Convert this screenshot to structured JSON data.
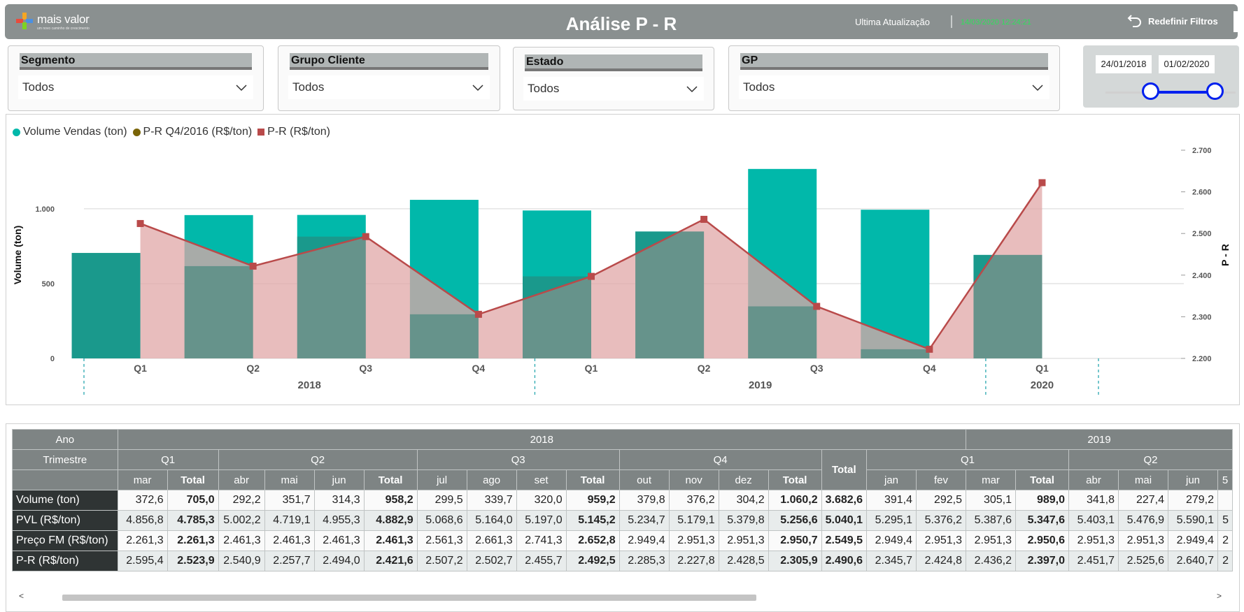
{
  "header": {
    "logo_text": "mais valor",
    "logo_sub": "um novo caminho de crescimento",
    "title": "Análise P - R",
    "update_label": "Ultima  Atualização",
    "update_time": "14/03/2020 12:24:21",
    "reset_label": "Redefinir Filtros",
    "reset_icon": "undo-icon"
  },
  "slicers": [
    {
      "title": "Segmento",
      "value": "Todos"
    },
    {
      "title": "Grupo Cliente",
      "value": "Todos"
    },
    {
      "title": "Estado",
      "value": "Todos"
    },
    {
      "title": "GP",
      "value": "Todos"
    }
  ],
  "date_slicer": {
    "start": "24/01/2018",
    "end": "01/02/2020",
    "start_fraction": 0.0,
    "end_fraction": 1.0
  },
  "colors": {
    "volume": "#01b8aa",
    "pr_q4": "#7a6408",
    "pr": "#b94a4a",
    "area_fill": "#e0a7a7",
    "header": "#8a9090"
  },
  "legend": [
    {
      "label": "Volume Vendas (ton)",
      "shape": "circle",
      "color": "#01b8aa"
    },
    {
      "label": "P-R Q4/2016 (R$/ton)",
      "shape": "circle",
      "color": "#7a6408"
    },
    {
      "label": "P-R (R$/ton)",
      "shape": "square",
      "color": "#b94a4a"
    }
  ],
  "chart_data": {
    "type": "bar",
    "categories": [
      "Q1",
      "Q2",
      "Q3",
      "Q4",
      "Q1",
      "Q2",
      "Q3",
      "Q4",
      "Q1"
    ],
    "groups": [
      {
        "label": "2018",
        "span": 4
      },
      {
        "label": "2019",
        "span": 4
      },
      {
        "label": "2020",
        "span": 1
      }
    ],
    "series": [
      {
        "name": "Volume Vendas (ton)",
        "type": "bar",
        "axis": "left",
        "values": [
          705.0,
          958.2,
          959.2,
          1060.2,
          989.0,
          848.4,
          1266.7,
          994.1,
          691.9
        ]
      },
      {
        "name": "P-R (R$/ton)",
        "type": "area-line",
        "axis": "right",
        "values": [
          2523.9,
          2421.6,
          2492.5,
          2305.9,
          2397.0,
          2534.0,
          2325.0,
          2222.0,
          2622.0
        ]
      }
    ],
    "ylabel": "Volume (ton)",
    "y2label": "P - R",
    "ylim": [
      0,
      1392
    ],
    "yticks": [
      0,
      500,
      1000
    ],
    "yticklabels": [
      "0",
      "500",
      "1.000"
    ],
    "y2lim": [
      2200,
      2700
    ],
    "y2ticks": [
      2200,
      2300,
      2400,
      2500,
      2600,
      2700
    ],
    "y2ticklabels": [
      "2.200",
      "2.300",
      "2.400",
      "2.500",
      "2.600",
      "2.700"
    ],
    "grid": true,
    "legend_position": "top-left"
  },
  "table": {
    "labels": {
      "ano": "Ano",
      "trimestre": "Trimestre"
    },
    "years": [
      {
        "label": "2018",
        "colspan": 17
      },
      {
        "label": "2019",
        "colspan": 8
      }
    ],
    "quarters": [
      {
        "label": "Q1",
        "colspan": 2
      },
      {
        "label": "Q2",
        "colspan": 4
      },
      {
        "label": "Q3",
        "colspan": 4
      },
      {
        "label": "Q4",
        "colspan": 4
      },
      {
        "label": "Total",
        "colspan": 1,
        "bold": true
      },
      {
        "label": "Q1",
        "colspan": 4
      },
      {
        "label": "Q2",
        "colspan": 4
      }
    ],
    "months": [
      {
        "label": "mar"
      },
      {
        "label": "Total",
        "bold": true
      },
      {
        "label": "abr"
      },
      {
        "label": "mai"
      },
      {
        "label": "jun"
      },
      {
        "label": "Total",
        "bold": true
      },
      {
        "label": "jul"
      },
      {
        "label": "ago"
      },
      {
        "label": "set"
      },
      {
        "label": "Total",
        "bold": true
      },
      {
        "label": "out"
      },
      {
        "label": "nov"
      },
      {
        "label": "dez"
      },
      {
        "label": "Total",
        "bold": true
      },
      {
        "label": "",
        "bold": true
      },
      {
        "label": "jan"
      },
      {
        "label": "fev"
      },
      {
        "label": "mar"
      },
      {
        "label": "Total",
        "bold": true
      },
      {
        "label": "abr"
      },
      {
        "label": "mai"
      },
      {
        "label": "jun"
      },
      {
        "label": "5"
      }
    ],
    "bold_cols": [
      1,
      5,
      9,
      13,
      14,
      18
    ],
    "rows": [
      {
        "label": "Volume (ton)",
        "values": [
          "372,6",
          "705,0",
          "292,2",
          "351,7",
          "314,3",
          "958,2",
          "299,5",
          "339,7",
          "320,0",
          "959,2",
          "379,8",
          "376,2",
          "304,2",
          "1.060,2",
          "3.682,6",
          "391,4",
          "292,5",
          "305,1",
          "989,0",
          "341,8",
          "227,4",
          "279,2",
          ""
        ]
      },
      {
        "label": "PVL (R$/ton)",
        "values": [
          "4.856,8",
          "4.785,3",
          "5.002,2",
          "4.719,1",
          "4.955,3",
          "4.882,9",
          "5.068,6",
          "5.164,0",
          "5.197,0",
          "5.145,2",
          "5.234,7",
          "5.179,1",
          "5.379,8",
          "5.256,6",
          "5.040,1",
          "5.295,1",
          "5.376,2",
          "5.387,6",
          "5.347,6",
          "5.403,1",
          "5.476,9",
          "5.590,1",
          "5"
        ]
      },
      {
        "label": "Preço FM (R$/ton)",
        "values": [
          "2.261,3",
          "2.261,3",
          "2.461,3",
          "2.461,3",
          "2.461,3",
          "2.461,3",
          "2.561,3",
          "2.661,3",
          "2.741,3",
          "2.652,8",
          "2.949,4",
          "2.951,3",
          "2.951,3",
          "2.950,7",
          "2.549,5",
          "2.949,4",
          "2.951,3",
          "2.951,3",
          "2.950,6",
          "2.951,3",
          "2.951,3",
          "2.949,4",
          "2"
        ]
      },
      {
        "label": "P-R (R$/ton)",
        "values": [
          "2.595,4",
          "2.523,9",
          "2.540,9",
          "2.257,7",
          "2.494,0",
          "2.421,6",
          "2.507,2",
          "2.502,7",
          "2.455,7",
          "2.492,5",
          "2.285,3",
          "2.227,8",
          "2.428,5",
          "2.305,9",
          "2.490,6",
          "2.345,7",
          "2.424,8",
          "2.436,2",
          "2.397,0",
          "2.451,7",
          "2.525,6",
          "2.640,7",
          "2"
        ]
      }
    ]
  },
  "scrollbar": {
    "left_arrow": "<",
    "right_arrow": ">"
  }
}
